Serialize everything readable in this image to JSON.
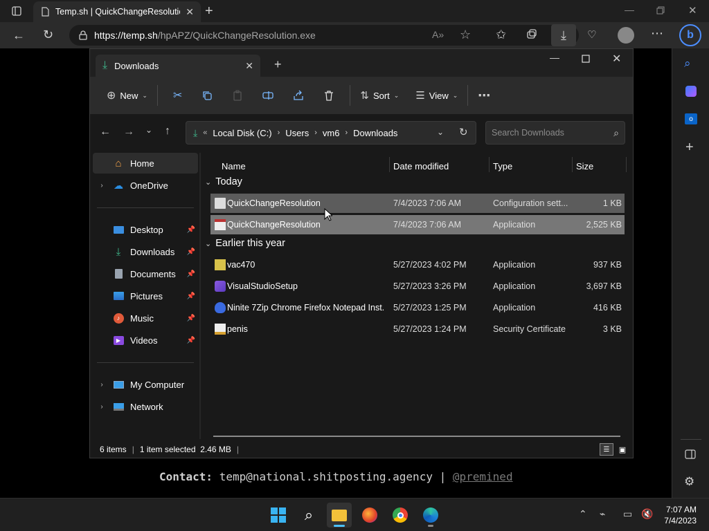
{
  "browser": {
    "tab_title": "Temp.sh | QuickChangeResolutio",
    "url_host": "https://temp.sh",
    "url_path": "/hpAPZ/QuickChangeResolution.exe"
  },
  "explorer": {
    "tab_title": "Downloads",
    "commands": {
      "new": "New",
      "sort": "Sort",
      "view": "View"
    },
    "breadcrumb": [
      "Local Disk (C:)",
      "Users",
      "vm6",
      "Downloads"
    ],
    "search_placeholder": "Search Downloads",
    "nav": {
      "home": "Home",
      "onedrive": "OneDrive",
      "quick": [
        {
          "label": "Desktop"
        },
        {
          "label": "Downloads"
        },
        {
          "label": "Documents"
        },
        {
          "label": "Pictures"
        },
        {
          "label": "Music"
        },
        {
          "label": "Videos"
        }
      ],
      "my_computer": "My Computer",
      "network": "Network"
    },
    "columns": {
      "name": "Name",
      "date": "Date modified",
      "type": "Type",
      "size": "Size"
    },
    "groups": {
      "today": "Today",
      "earlier": "Earlier this year"
    },
    "files_today": [
      {
        "name": "QuickChangeResolution",
        "date": "7/4/2023 7:06 AM",
        "type": "Configuration sett...",
        "size": "1 KB"
      },
      {
        "name": "QuickChangeResolution",
        "date": "7/4/2023 7:06 AM",
        "type": "Application",
        "size": "2,525 KB"
      }
    ],
    "files_earlier": [
      {
        "name": "vac470",
        "date": "5/27/2023 4:02 PM",
        "type": "Application",
        "size": "937 KB"
      },
      {
        "name": "VisualStudioSetup",
        "date": "5/27/2023 3:26 PM",
        "type": "Application",
        "size": "3,697 KB"
      },
      {
        "name": "Ninite 7Zip Chrome Firefox Notepad Inst...",
        "date": "5/27/2023 1:25 PM",
        "type": "Application",
        "size": "416 KB"
      },
      {
        "name": "penis",
        "date": "5/27/2023 1:24 PM",
        "type": "Security Certificate",
        "size": "3 KB"
      }
    ],
    "status": {
      "items": "6 items",
      "selected": "1 item selected  2.46 MB"
    }
  },
  "contact": {
    "label": "Contact:",
    "email": "temp@national.shitposting.agency",
    "sep": "|",
    "handle": "@premined"
  },
  "clock": {
    "time": "7:07 AM",
    "date": "7/4/2023"
  },
  "colors": {
    "accent": "#4cc2ff",
    "selection": "#777777",
    "download_green": "#3fb68b"
  }
}
